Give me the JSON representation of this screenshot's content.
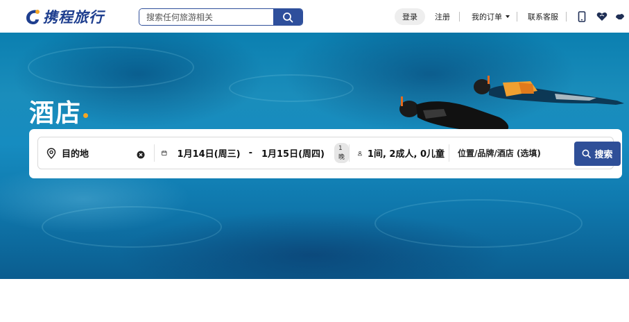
{
  "header": {
    "logo_text": "携程旅行",
    "search": {
      "placeholder": "搜索任何旅游相关"
    },
    "nav": {
      "login": "登录",
      "register": "注册",
      "orders": "我的订单",
      "service": "联系客服"
    },
    "icons": [
      "mobile-icon",
      "heart-icon",
      "handshake-icon"
    ]
  },
  "hero": {
    "title": "酒店",
    "accent_color": "#f5a623"
  },
  "booking": {
    "destination": {
      "placeholder": "目的地"
    },
    "checkin": "1月14日(周三)",
    "date_separator": "-",
    "checkout": "1月15日(周四)",
    "nights": "1晚",
    "guests": "1间, 2成人, 0儿童",
    "keyword": {
      "placeholder": "位置/品牌/酒店 (选填)"
    },
    "submit_label": "搜索"
  },
  "colors": {
    "brand": "#2e4f9c",
    "accent": "#f5a623"
  }
}
